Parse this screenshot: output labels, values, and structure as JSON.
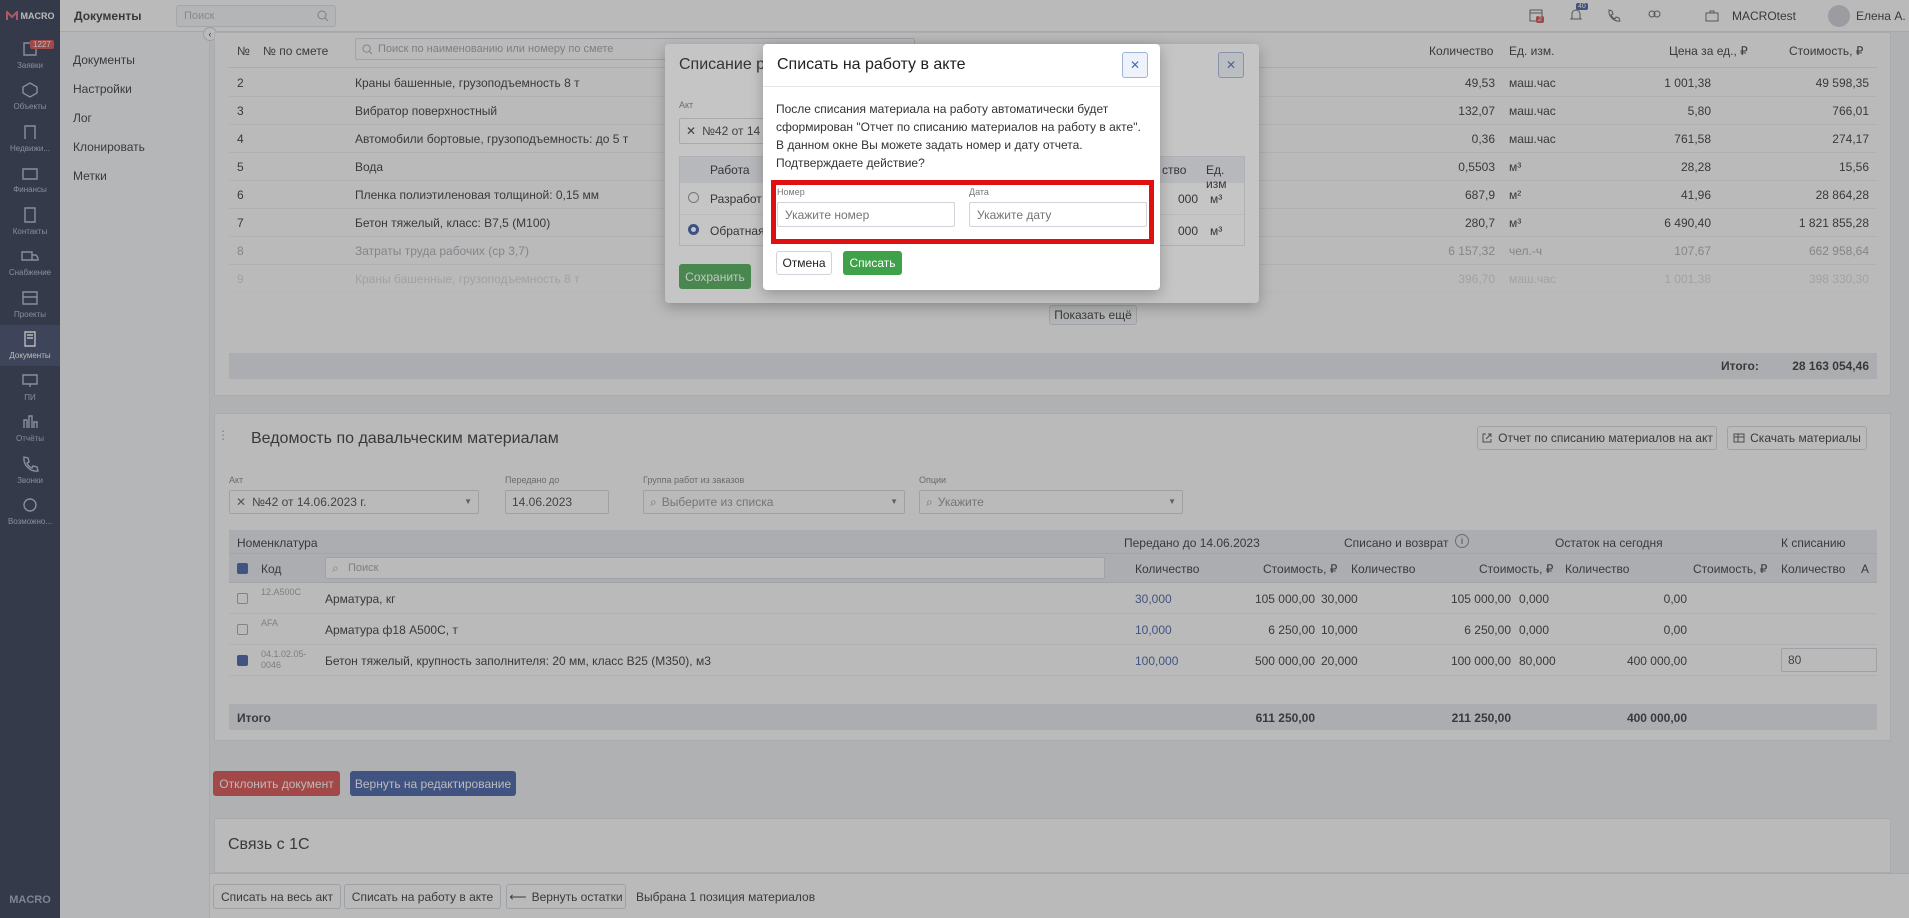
{
  "sidebar": {
    "logo": "MACRO",
    "items": [
      {
        "label": "Заявки",
        "badge": "1227",
        "icon": "inbox-icon"
      },
      {
        "label": "Объекты",
        "icon": "cube-icon"
      },
      {
        "label": "Недвижи...",
        "icon": "building-icon"
      },
      {
        "label": "Финансы",
        "icon": "wallet-icon"
      },
      {
        "label": "Контакты",
        "icon": "contacts-icon"
      },
      {
        "label": "Снабжение",
        "icon": "truck-icon"
      },
      {
        "label": "Проекты",
        "icon": "projects-icon"
      },
      {
        "label": "Документы",
        "icon": "document-icon"
      },
      {
        "label": "ПИ",
        "icon": "monitor-icon"
      },
      {
        "label": "Отчёты",
        "icon": "chart-icon"
      },
      {
        "label": "Звонки",
        "icon": "phone-icon"
      },
      {
        "label": "Возможно...",
        "icon": "settings-icon"
      }
    ],
    "footer": "MACRO"
  },
  "topbar": {
    "section_title": "Документы",
    "search_placeholder": "Поиск",
    "calendar_badge": "2",
    "bell_badge": "40",
    "company": "MACROtest",
    "user": "Елена А."
  },
  "subnav": {
    "items": [
      "Документы",
      "Настройки",
      "Лог",
      "Клонировать",
      "Метки"
    ]
  },
  "estimate_table": {
    "headers": {
      "num": "№",
      "smeta_num": "№ по смете",
      "search_placeholder": "Поиск по наименованию или номеру по смете",
      "qty": "Количество",
      "unit": "Ед. изм.",
      "price": "Цена за ед., ₽",
      "cost": "Стоимость, ₽"
    },
    "rows": [
      {
        "num": "2",
        "name": "Краны башенные, грузоподъемность 8 т",
        "qty": "49,53",
        "unit": "маш.час",
        "price": "1 001,38",
        "cost": "49 598,35"
      },
      {
        "num": "3",
        "name": "Вибратор поверхностный",
        "qty": "132,07",
        "unit": "маш.час",
        "price": "5,80",
        "cost": "766,01"
      },
      {
        "num": "4",
        "name": "Автомобили бортовые, грузоподъемность: до 5 т",
        "qty": "0,36",
        "unit": "маш.час",
        "price": "761,58",
        "cost": "274,17"
      },
      {
        "num": "5",
        "name": "Вода",
        "qty": "0,5503",
        "unit": "м³",
        "price": "28,28",
        "cost": "15,56"
      },
      {
        "num": "6",
        "name": "Пленка полиэтиленовая толщиной: 0,15 мм",
        "qty": "687,9",
        "unit": "м²",
        "price": "41,96",
        "cost": "28 864,28"
      },
      {
        "num": "7",
        "name": "Бетон тяжелый, класс: B7,5 (M100)",
        "qty": "280,7",
        "unit": "м³",
        "price": "6 490,40",
        "cost": "1 821 855,28"
      },
      {
        "num": "8",
        "name": "Затраты труда рабочих (ср 3,7)",
        "qty": "6 157,32",
        "unit": "чел.-ч",
        "price": "107,67",
        "cost": "662 958,64"
      },
      {
        "num": "9",
        "name": "Краны башенные, грузоподъемность 8 т",
        "qty": "396,70",
        "unit": "маш.час",
        "price": "1 001,38",
        "cost": "398 330,30"
      }
    ],
    "show_more": "Показать ещё",
    "total_label": "Итого:",
    "total_value": "28 163 054,46"
  },
  "materials": {
    "title": "Ведомость по давальческим материалам",
    "report_button": "Отчет по списанию материалов на акт",
    "download_button": "Скачать материалы",
    "filters": {
      "act_label": "Акт",
      "act_value": "№42 от 14.06.2023 г.",
      "transferred_label": "Передано до",
      "transferred_value": "14.06.2023",
      "group_label": "Группа работ из заказов",
      "group_placeholder": "Выберите из списка",
      "options_label": "Опции",
      "options_placeholder": "Укажите"
    },
    "headers": {
      "nomenclature": "Номенклатура",
      "transferred": "Передано до 14.06.2023",
      "written_off": "Списано и возврат",
      "remaining": "Остаток на сегодня",
      "to_write_off": "К списанию",
      "code": "Код",
      "search_placeholder": "Поиск",
      "qty": "Количество",
      "cost": "Стоимость, ₽",
      "a": "А"
    },
    "rows": [
      {
        "code": "12.А500С",
        "name": "Арматура, кг",
        "t_qty": "30,000",
        "t_cost": "105 000,00",
        "w_qty": "30,000",
        "w_cost": "105 000,00",
        "r_qty": "0,000",
        "r_cost": "0,00",
        "to_write": "",
        "checked": false
      },
      {
        "code": "AFA",
        "name": "Арматура ф18 А500С, т",
        "t_qty": "10,000",
        "t_cost": "6 250,00",
        "w_qty": "10,000",
        "w_cost": "6 250,00",
        "r_qty": "0,000",
        "r_cost": "0,00",
        "to_write": "",
        "checked": false
      },
      {
        "code": "04.1.02.05-0046",
        "name": "Бетон тяжелый, крупность заполнителя: 20 мм, класс B25 (М350), м3",
        "t_qty": "100,000",
        "t_cost": "500 000,00",
        "w_qty": "20,000",
        "w_cost": "100 000,00",
        "r_qty": "80,000",
        "r_cost": "400 000,00",
        "to_write": "80",
        "checked": true
      }
    ],
    "total": {
      "label": "Итого",
      "t_cost": "611 250,00",
      "w_cost": "211 250,00",
      "r_cost": "400 000,00"
    }
  },
  "actions": {
    "reject": "Отклонить документ",
    "return": "Вернуть на редактирование"
  },
  "link_1c": {
    "title": "Связь с 1С"
  },
  "bottombar": {
    "write_all": "Списать на весь акт",
    "write_work": "Списать на работу в акте",
    "return_rest": "Вернуть остатки",
    "selected": "Выбрана 1 позиция материалов"
  },
  "back_modal": {
    "title": "Списание р",
    "act_label": "Акт",
    "act_value": "№42 от 14",
    "col_work": "Работа",
    "col_qty_fragment": "ство",
    "col_unit": "Ед. изм",
    "rows": [
      {
        "work": "Разработ",
        "qty": "000",
        "unit": "м³"
      },
      {
        "work": "Обратная",
        "qty": "000",
        "unit": "м³"
      }
    ],
    "save": "Сохранить"
  },
  "modal": {
    "title": "Списать на работу в акте",
    "text": "После списания материала на работу автоматически будет сформирован \"Отчет по списанию материалов на работу в акте\". В данном окне Вы можете задать номер и дату отчета. Подтверждаете действие?",
    "number_label": "Номер",
    "number_placeholder": "Укажите номер",
    "date_label": "Дата",
    "date_placeholder": "Укажите дату",
    "cancel": "Отмена",
    "confirm": "Списать",
    "highlight_color": "#e01010"
  }
}
